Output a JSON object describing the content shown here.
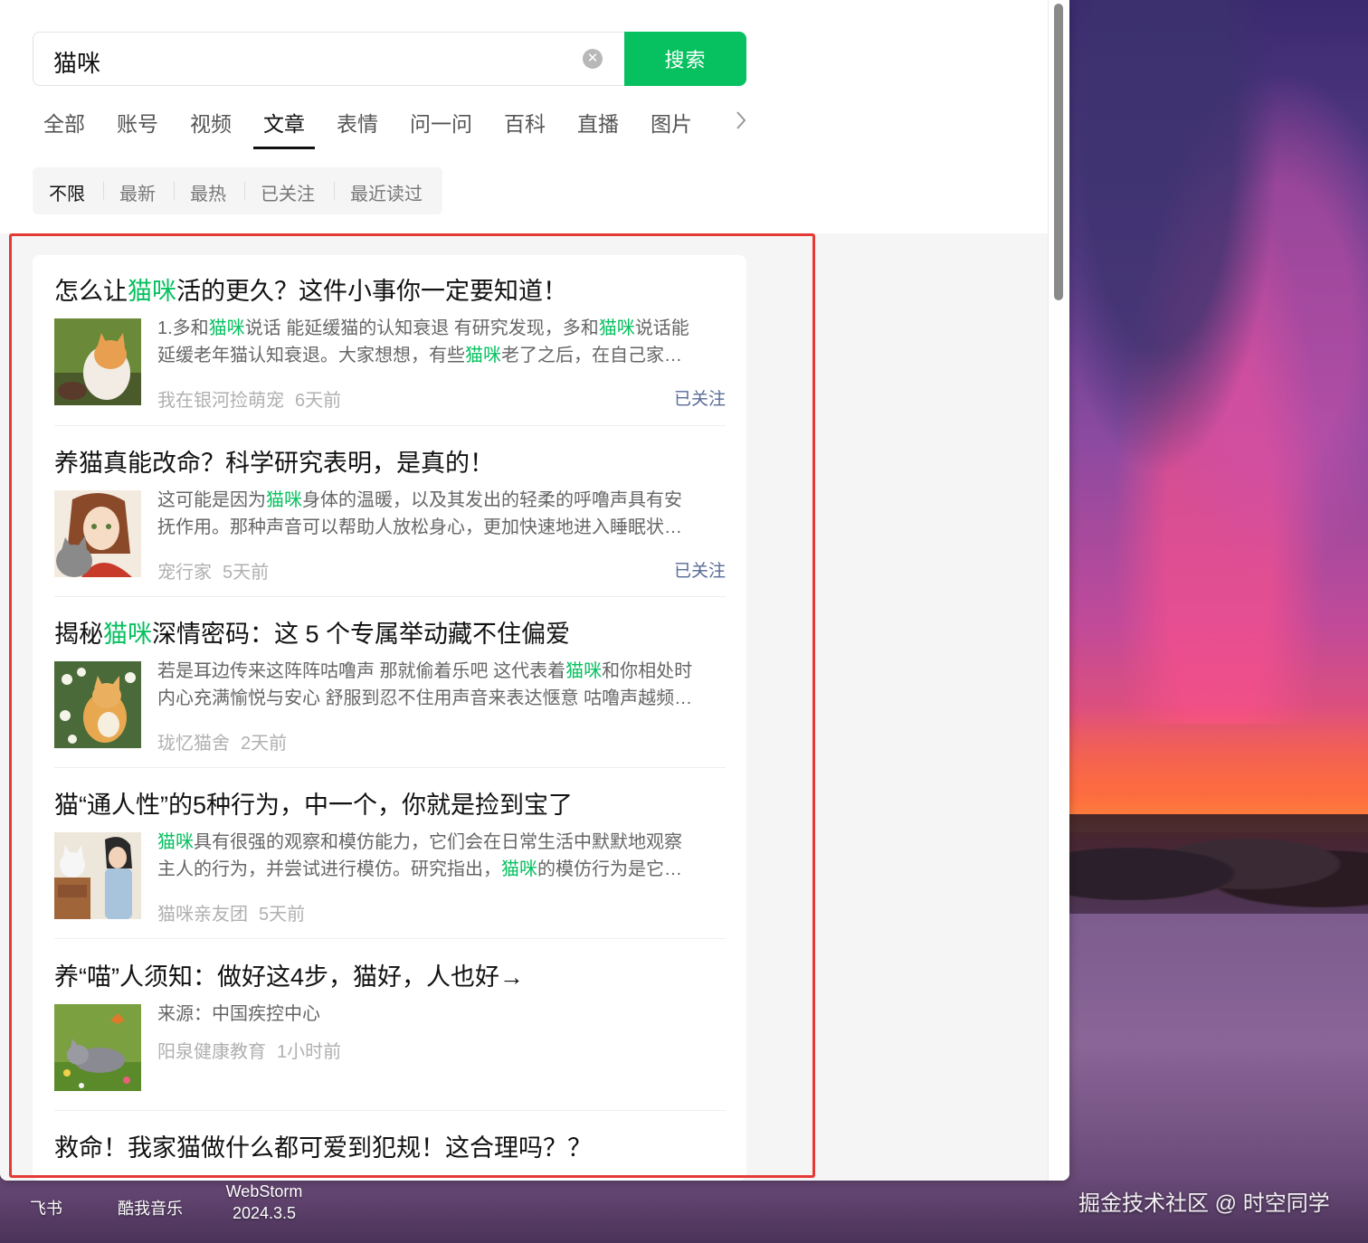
{
  "search": {
    "query": "猫咪",
    "clear_icon": "✕",
    "button_label": "搜索"
  },
  "tabs": [
    {
      "label": "全部",
      "active": false
    },
    {
      "label": "账号",
      "active": false
    },
    {
      "label": "视频",
      "active": false
    },
    {
      "label": "文章",
      "active": true
    },
    {
      "label": "表情",
      "active": false
    },
    {
      "label": "问一问",
      "active": false
    },
    {
      "label": "百科",
      "active": false
    },
    {
      "label": "直播",
      "active": false
    },
    {
      "label": "图片",
      "active": false
    }
  ],
  "tabs_more_icon": "chevron-right-icon",
  "filters": [
    {
      "label": "不限",
      "active": true
    },
    {
      "label": "最新",
      "active": false
    },
    {
      "label": "最热",
      "active": false
    },
    {
      "label": "已关注",
      "active": false
    },
    {
      "label": "最近读过",
      "active": false
    }
  ],
  "results": [
    {
      "title_parts": [
        "怎么让",
        "猫咪",
        "活的更久？这件小事你一定要知道！"
      ],
      "desc_line1_parts": [
        "1.多和",
        "猫咪",
        "说话 能延缓猫的认知衰退 有研究发现，多和",
        "猫咪",
        "说话能"
      ],
      "desc_line2_parts": [
        "延缓老年猫认知衰退。大家想想，有些",
        "猫咪",
        "老了之后，在自己家…"
      ],
      "source": "我在银河捡萌宠",
      "time": "6天前",
      "badge": "已关注"
    },
    {
      "title_parts": [
        "养猫真能改命？科学研究表明，是真的！"
      ],
      "desc_line1_parts": [
        "这可能是因为",
        "猫咪",
        "身体的温暖，以及其发出的轻柔的呼噜声具有安"
      ],
      "desc_line2_parts": [
        "抚作用。那种声音可以帮助人放松身心，更加快速地进入睡眠状…"
      ],
      "source": "宠行家",
      "time": "5天前",
      "badge": "已关注"
    },
    {
      "title_parts": [
        "揭秘",
        "猫咪",
        "深情密码：这 5 个专属举动藏不住偏爱"
      ],
      "desc_line1_parts": [
        "若是耳边传来这阵阵咕噜声 那就偷着乐吧 这代表着",
        "猫咪",
        "和你相处时"
      ],
      "desc_line2_parts": [
        "内心充满愉悦与安心 舒服到忍不住用声音来表达惬意 咕噜声越频…"
      ],
      "source": "珑忆猫舍",
      "time": "2天前",
      "badge": ""
    },
    {
      "title_parts": [
        "猫“通人性”的5种行为，中一个，你就是捡到宝了"
      ],
      "desc_line1_parts": [
        "",
        "猫咪",
        "具有很强的观察和模仿能力，它们会在日常生活中默默地观察"
      ],
      "desc_line2_parts": [
        "主人的行为，并尝试进行模仿。研究指出，",
        "猫咪",
        "的模仿行为是它…"
      ],
      "source": "猫咪亲友团",
      "time": "5天前",
      "badge": ""
    },
    {
      "title_parts": [
        "养“喵”人须知：做好这4步，猫好，人也好→"
      ],
      "desc_line1_parts": [
        "来源：中国疾控中心"
      ],
      "desc_line2_parts": [],
      "source": "阳泉健康教育",
      "time": "1小时前",
      "badge": ""
    },
    {
      "title_parts": [
        "救命！我家猫做什么都可爱到犯规！这合理吗？？"
      ],
      "desc_line1_parts": [],
      "desc_line2_parts": [],
      "source": "",
      "time": "",
      "badge": ""
    }
  ],
  "taskbar": {
    "items": [
      "飞书",
      "酷我音乐",
      "WebStorm\n2024.3.5"
    ]
  },
  "watermark": "掘金技术社区 @ 时空同学",
  "colors": {
    "accent_green": "#07c160",
    "highlight": "#07c160",
    "followed_link": "#576b95",
    "annotation_red": "#e53935"
  }
}
